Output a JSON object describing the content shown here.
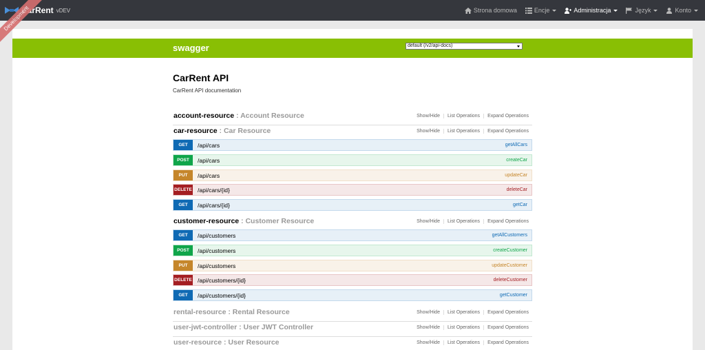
{
  "navbar": {
    "brand": "CarRent",
    "version": "vDEV",
    "items": [
      {
        "label": "Strona domowa",
        "icon": "home-icon",
        "caret": false
      },
      {
        "label": "Encje",
        "icon": "list-icon",
        "caret": true
      },
      {
        "label": "Administracja",
        "icon": "user-plus-icon",
        "caret": true,
        "active": true
      },
      {
        "label": "Język",
        "icon": "flag-icon",
        "caret": true
      },
      {
        "label": "Konto",
        "icon": "user-icon",
        "caret": true
      }
    ]
  },
  "ribbon": "Development",
  "swagger": {
    "logo": "swagger",
    "select": "default (/v2/api-docs)"
  },
  "api": {
    "title": "CarRent API",
    "description": "CarRent API documentation"
  },
  "resource_links": [
    "Show/Hide",
    "List Operations",
    "Expand Operations"
  ],
  "resources": [
    {
      "name": "account-resource",
      "desc": "Account Resource"
    },
    {
      "name": "car-resource",
      "desc": "Car Resource"
    },
    {
      "name": "customer-resource",
      "desc": "Customer Resource"
    },
    {
      "name": "rental-resource",
      "desc": "Rental Resource"
    },
    {
      "name": "user-jwt-controller",
      "desc": "User JWT Controller"
    },
    {
      "name": "user-resource",
      "desc": "User Resource"
    }
  ],
  "car_ops": [
    {
      "method": "GET",
      "path": "/api/cars",
      "nick": "getAllCars"
    },
    {
      "method": "POST",
      "path": "/api/cars",
      "nick": "createCar"
    },
    {
      "method": "PUT",
      "path": "/api/cars",
      "nick": "updateCar"
    },
    {
      "method": "DELETE",
      "path": "/api/cars/{id}",
      "nick": "deleteCar"
    },
    {
      "method": "GET",
      "path": "/api/cars/{id}",
      "nick": "getCar"
    }
  ],
  "customer_ops": [
    {
      "method": "GET",
      "path": "/api/customers",
      "nick": "getAllCustomers"
    },
    {
      "method": "POST",
      "path": "/api/customers",
      "nick": "createCustomer"
    },
    {
      "method": "PUT",
      "path": "/api/customers",
      "nick": "updateCustomer"
    },
    {
      "method": "DELETE",
      "path": "/api/customers/{id}",
      "nick": "deleteCustomer"
    },
    {
      "method": "GET",
      "path": "/api/customers/{id}",
      "nick": "getCustomer"
    }
  ],
  "colors": {
    "navbar": "#35373d",
    "swagger_green": "#89bf04",
    "get": "#0f6ab4",
    "post": "#10a54a",
    "put": "#c5862b",
    "delete": "#a41e22"
  }
}
